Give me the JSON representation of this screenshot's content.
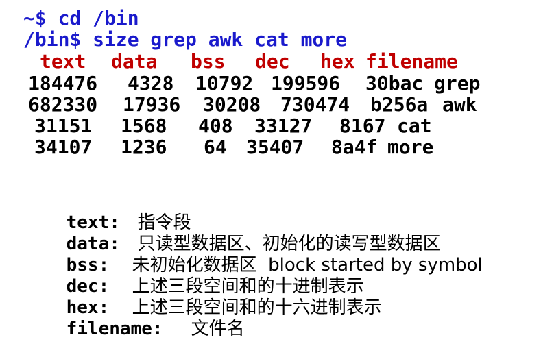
{
  "colors": {
    "command": "#1a1acc",
    "header": "#c00000",
    "text": "#000000"
  },
  "terminal": {
    "commands": [
      "~$ cd /bin",
      "/bin$ size grep awk cat more"
    ],
    "headers": [
      "text",
      "data",
      "bss",
      "dec",
      "hex",
      "filename"
    ],
    "rows": [
      [
        "184476",
        "4328",
        "10792",
        "199596",
        "30bac",
        "grep"
      ],
      [
        "682330",
        "17936",
        "30208",
        "730474",
        "b256a",
        "awk"
      ],
      [
        "31151",
        "1568",
        "408",
        "33127",
        "8167",
        "cat"
      ],
      [
        "34107",
        "1236",
        "64",
        "35407",
        "8a4f",
        "more"
      ]
    ]
  },
  "legend": [
    {
      "term": "text:",
      "desc": "指令段"
    },
    {
      "term": "data:",
      "desc": "只读型数据区、初始化的读写型数据区"
    },
    {
      "term": "bss:",
      "desc": "未初始化数据区  block started by symbol"
    },
    {
      "term": "dec:",
      "desc": "上述三段空间和的十进制表示"
    },
    {
      "term": "hex:",
      "desc": "上述三段空间和的十六进制表示"
    },
    {
      "term": "filename:",
      "desc": "文件名"
    }
  ]
}
